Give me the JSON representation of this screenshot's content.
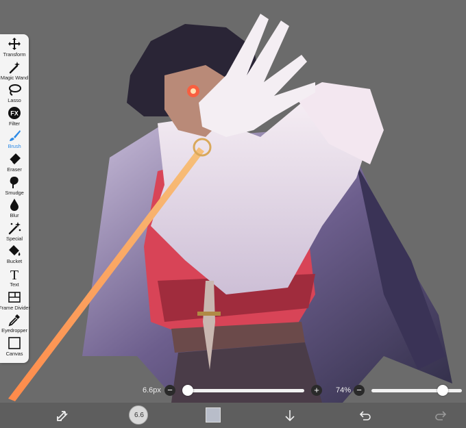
{
  "tools": [
    {
      "id": "transform",
      "label": "Transform",
      "icon": "move-arrows-icon",
      "active": false
    },
    {
      "id": "magic-wand",
      "label": "Magic Wand",
      "icon": "magic-wand-icon",
      "active": false
    },
    {
      "id": "lasso",
      "label": "Lasso",
      "icon": "lasso-icon",
      "active": false
    },
    {
      "id": "filter",
      "label": "Filter",
      "icon": "fx-icon",
      "active": false
    },
    {
      "id": "brush",
      "label": "Brush",
      "icon": "brush-icon",
      "active": true
    },
    {
      "id": "eraser",
      "label": "Eraser",
      "icon": "eraser-icon",
      "active": false
    },
    {
      "id": "smudge",
      "label": "Smudge",
      "icon": "smudge-icon",
      "active": false
    },
    {
      "id": "blur",
      "label": "Blur",
      "icon": "drop-icon",
      "active": false
    },
    {
      "id": "special",
      "label": "Special",
      "icon": "special-wand-icon",
      "active": false
    },
    {
      "id": "bucket",
      "label": "Bucket",
      "icon": "bucket-icon",
      "active": false
    },
    {
      "id": "text",
      "label": "Text",
      "icon": "text-icon",
      "active": false
    },
    {
      "id": "frame-divider",
      "label": "Frame Divider",
      "icon": "frame-divider-icon",
      "active": false
    },
    {
      "id": "eyedropper",
      "label": "Eyedropper",
      "icon": "eyedropper-icon",
      "active": false
    },
    {
      "id": "canvas",
      "label": "Canvas",
      "icon": "canvas-icon",
      "active": false
    }
  ],
  "filter_glyph": "FX",
  "text_glyph": "T",
  "brush_size": {
    "value_text": "6.6px",
    "minus": "−",
    "plus": "+",
    "level": 0.0
  },
  "opacity": {
    "value_text": "74%",
    "minus": "−",
    "level": 0.74
  },
  "bottom_bar": {
    "brush_preview_text": "6.6",
    "color_hex": "#b8bdc9",
    "icons": [
      "shuffle-icon",
      "brush-preview-icon",
      "color-swatch-icon",
      "download-arrow-icon",
      "undo-icon",
      "redo-icon"
    ]
  },
  "colors": {
    "accent": "#2e8be6",
    "toolbar_bg": "#f4f4f4",
    "canvas_bg": "#6b6b6b",
    "bottom_bar_bg": "#5e5e5e"
  }
}
